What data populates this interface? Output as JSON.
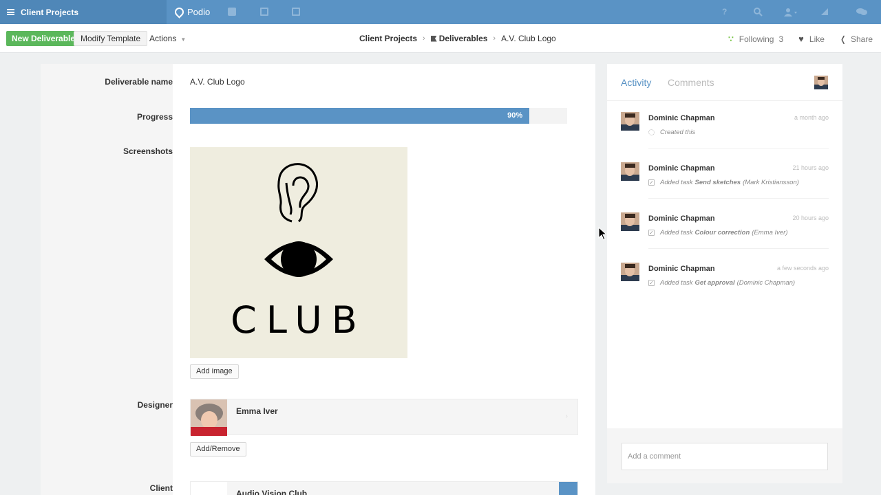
{
  "topbar": {
    "workspace": "Client Projects",
    "brand": "Podio",
    "help": "?"
  },
  "actionbar": {
    "new_button": "New Deliverable",
    "modify_button": "Modify Template",
    "actions_label": "Actions",
    "breadcrumb": [
      "Client Projects",
      "Deliverables",
      "A.V. Club Logo"
    ],
    "following_label": "Following",
    "following_count": "3",
    "like_label": "Like",
    "share_label": "Share"
  },
  "item": {
    "labels": {
      "name": "Deliverable name",
      "progress": "Progress",
      "screenshots": "Screenshots",
      "designer": "Designer",
      "client": "Client"
    },
    "name": "A.V. Club Logo",
    "progress_value": 90,
    "progress_text": "90%",
    "screenshot_logo_text": "CLUB",
    "add_image": "Add image",
    "designer_name": "Emma Iver",
    "add_remove": "Add/Remove",
    "client_name": "Audio Vision Club"
  },
  "sidebar": {
    "tab_activity": "Activity",
    "tab_comments": "Comments",
    "activity": [
      {
        "who": "Dominic Chapman",
        "when": "a month ago",
        "icon": "sun-icon",
        "pre": "Created this",
        "task": "",
        "assignee": ""
      },
      {
        "who": "Dominic Chapman",
        "when": "21 hours ago",
        "icon": "check-icon",
        "pre": "Added task",
        "task": "Send sketches",
        "assignee": "(Mark Kristiansson)"
      },
      {
        "who": "Dominic Chapman",
        "when": "20 hours ago",
        "icon": "check-icon",
        "pre": "Added task",
        "task": "Colour correction",
        "assignee": "(Emma Iver)"
      },
      {
        "who": "Dominic Chapman",
        "when": "a few seconds ago",
        "icon": "check-icon",
        "pre": "Added task",
        "task": "Get approval",
        "assignee": "(Dominic Chapman)"
      }
    ],
    "comment_placeholder": "Add a comment"
  },
  "colors": {
    "topbar": "#5a93c5",
    "accent": "#5a93c5",
    "new_button": "#5bb75b"
  }
}
